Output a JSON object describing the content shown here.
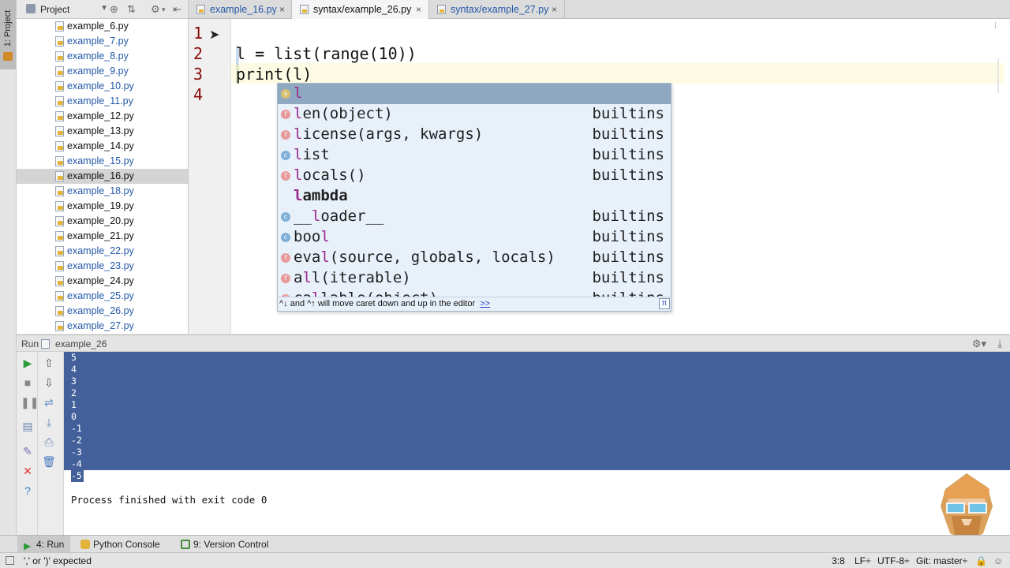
{
  "left_strip": {
    "project_label": "1: Project"
  },
  "project_panel": {
    "dropdown_label": "Project",
    "files": [
      {
        "name": "example_6.py",
        "vcs": "none"
      },
      {
        "name": "example_7.py",
        "vcs": "blue"
      },
      {
        "name": "example_8.py",
        "vcs": "blue"
      },
      {
        "name": "example_9.py",
        "vcs": "blue"
      },
      {
        "name": "example_10.py",
        "vcs": "blue"
      },
      {
        "name": "example_11.py",
        "vcs": "blue"
      },
      {
        "name": "example_12.py",
        "vcs": "none"
      },
      {
        "name": "example_13.py",
        "vcs": "none"
      },
      {
        "name": "example_14.py",
        "vcs": "none"
      },
      {
        "name": "example_15.py",
        "vcs": "blue"
      },
      {
        "name": "example_16.py",
        "vcs": "none",
        "selected": true
      },
      {
        "name": "example_18.py",
        "vcs": "blue"
      },
      {
        "name": "example_19.py",
        "vcs": "none"
      },
      {
        "name": "example_20.py",
        "vcs": "none"
      },
      {
        "name": "example_21.py",
        "vcs": "none"
      },
      {
        "name": "example_22.py",
        "vcs": "blue"
      },
      {
        "name": "example_23.py",
        "vcs": "blue"
      },
      {
        "name": "example_24.py",
        "vcs": "none"
      },
      {
        "name": "example_25.py",
        "vcs": "blue"
      },
      {
        "name": "example_26.py",
        "vcs": "blue"
      },
      {
        "name": "example_27.py",
        "vcs": "blue"
      }
    ]
  },
  "tabs": [
    {
      "label": "example_16.py",
      "active": false
    },
    {
      "label": "syntax/example_26.py",
      "active": true
    },
    {
      "label": "syntax/example_27.py",
      "active": false
    }
  ],
  "tab_close_glyph": "×",
  "editor": {
    "line_numbers": [
      "1",
      "2",
      "3",
      "4"
    ],
    "lines": [
      "",
      "l = list(range(10))",
      "print(l)",
      ""
    ]
  },
  "completion": {
    "items": [
      {
        "icon": "v",
        "match": "l",
        "rest": "",
        "source": "",
        "selected": true
      },
      {
        "icon": "f",
        "match": "l",
        "rest": "en(object)",
        "source": "builtins"
      },
      {
        "icon": "f",
        "match": "l",
        "rest": "icense(args, kwargs)",
        "source": "builtins"
      },
      {
        "icon": "c",
        "match": "l",
        "rest": "ist",
        "source": "builtins"
      },
      {
        "icon": "f",
        "match": "l",
        "rest": "ocals()",
        "source": "builtins"
      },
      {
        "icon": "",
        "match": "l",
        "rest": "ambda",
        "source": "",
        "keyword": true
      },
      {
        "icon": "c",
        "pre": "__",
        "match": "l",
        "rest": "oader__",
        "source": "builtins"
      },
      {
        "icon": "c",
        "pre": "boo",
        "match": "l",
        "rest": "",
        "source": "builtins"
      },
      {
        "icon": "f",
        "pre": "eva",
        "match": "l",
        "rest": "(source, globals, locals)",
        "source": "builtins"
      },
      {
        "icon": "f",
        "pre": "a",
        "match": "l",
        "rest": "l(iterable)",
        "source": "builtins"
      },
      {
        "icon": "f",
        "pre": "ca",
        "match": "l",
        "rest": "lable(object)",
        "source": "builtins"
      }
    ],
    "hint": "^↓ and ^↑ will move caret down and up in the editor",
    "hint_link": ">>",
    "pi_glyph": "π"
  },
  "run": {
    "title": "Run",
    "config": "example_26",
    "output": [
      "5",
      "4",
      "3",
      "2",
      "1",
      "0",
      "-1",
      "-2",
      "-3",
      "-4",
      "-5"
    ],
    "exit_message": "Process finished with exit code 0"
  },
  "bottom_tabs": {
    "run": "4: Run",
    "python_console": "Python Console",
    "version_control": "9: Version Control"
  },
  "status": {
    "message": "',' or ')' expected",
    "position": "3:8",
    "line_sep": "LF÷",
    "encoding": "UTF-8÷",
    "vcs": "Git: master÷"
  },
  "colors": {
    "selection": "#43609b",
    "vcs_modified": "#2358a8",
    "line_number": "#8a0c0c"
  }
}
